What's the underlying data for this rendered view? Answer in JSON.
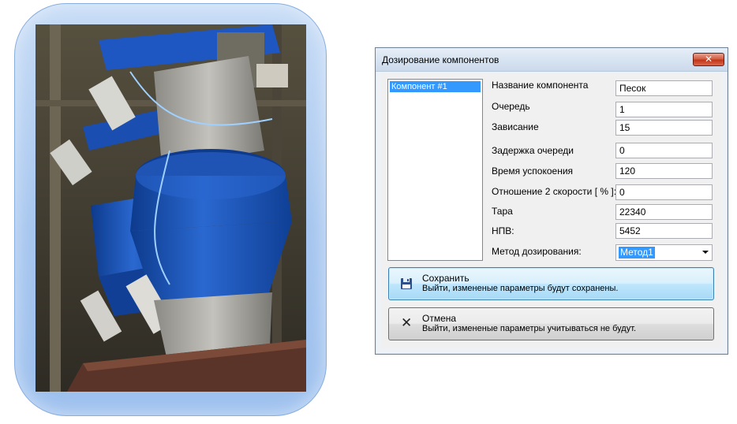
{
  "window": {
    "title": "Дозирование компонентов",
    "close_icon": "close-icon"
  },
  "components": {
    "items": [
      "Компонент #1"
    ],
    "selected": "Компонент #1"
  },
  "fields": [
    {
      "label": "Название компонента",
      "value": "Песок"
    },
    {
      "label": "Очередь",
      "value": "1"
    },
    {
      "label": "Зависание",
      "value": "15"
    },
    {
      "label": "Задержка очереди",
      "value": "0"
    },
    {
      "label": "Время успокоения",
      "value": "120"
    },
    {
      "label": "Отношение 2 скорости [ % ]:",
      "value": "0"
    },
    {
      "label": "Тара",
      "value": "22340"
    },
    {
      "label": "НПВ:",
      "value": "5452"
    }
  ],
  "method": {
    "label": "Метод дозирования:",
    "value": "Метод1"
  },
  "buttons": {
    "save": {
      "title": "Сохранить",
      "description": "Выйти, измененые параметры будут сохранены.",
      "icon": "floppy-disk-icon"
    },
    "cancel": {
      "title": "Отмена",
      "description": "Выйти, измененые параметры учитываться не будут.",
      "icon": "close-icon"
    }
  },
  "colors": {
    "selection": "#3399ff",
    "save_button": "#bee6fd",
    "close_button": "#c2361a",
    "photo_frame": "#a6c6ef",
    "hopper_blue": "#1d54b8"
  }
}
